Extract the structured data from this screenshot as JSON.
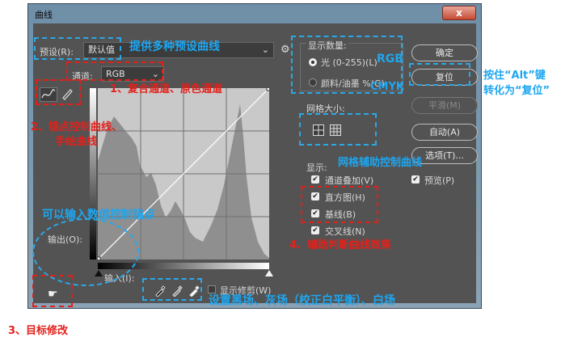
{
  "window": {
    "title": "曲线",
    "close_symbol": "x"
  },
  "preset": {
    "label": "预设(R):",
    "value": "默认值"
  },
  "channel": {
    "label": "通道:",
    "value": "RGB"
  },
  "display_amount": {
    "title": "显示数量:",
    "option_light": "光 (0-255)(L)",
    "option_pigment": "颜料/油墨 %(G)",
    "selected": "光 (0-255)(L)"
  },
  "grid_size": {
    "title": "网格大小:"
  },
  "show": {
    "title": "显示:",
    "channel_overlay": "通道叠加(V)",
    "histogram": "直方图(H)",
    "baseline": "基线(B)",
    "intersection": "交叉线(N)",
    "preview": "预览(P)"
  },
  "io": {
    "output_label": "输出(O):",
    "input_label": "输入(I):",
    "show_clipping": "显示修剪(W)"
  },
  "buttons": {
    "ok": "确定",
    "reset": "复位",
    "smooth": "平滑(M)",
    "auto": "自动(A)",
    "options": "选项(T)..."
  },
  "annotations": {
    "preset_curves": "提供多种预设曲线",
    "rgb": "RGB",
    "cmyk": "CMYK",
    "alt_reset_line1": "按住“Alt”键",
    "alt_reset_line2": "转化为“复位”",
    "composite_channel": "1、复合通道、原色通道",
    "anchor_curve_line1": "2、锚点控制曲线、",
    "anchor_curve_line2": "手绘曲线",
    "grid_aux": "网格辅助控制曲线",
    "input_values": "可以输入数值控制锚点",
    "judge_effect": "4、辅助判断曲线效果",
    "set_black_gray_white": "设置黑场、灰场（校正白平衡）、白场",
    "target_adjust": "3、目标修改"
  },
  "colors": {
    "annotation_blue": "#1ea6f0",
    "annotation_red": "#e3211b",
    "dialog_bg": "#535353"
  },
  "icons": [
    "close-icon",
    "gear-icon",
    "dropdown-arrow-icon",
    "curve-point-icon",
    "pencil-icon",
    "small-grid-icon",
    "large-grid-icon",
    "target-adjust-icon",
    "black-eyedropper-icon",
    "gray-eyedropper-icon",
    "white-eyedropper-icon"
  ]
}
